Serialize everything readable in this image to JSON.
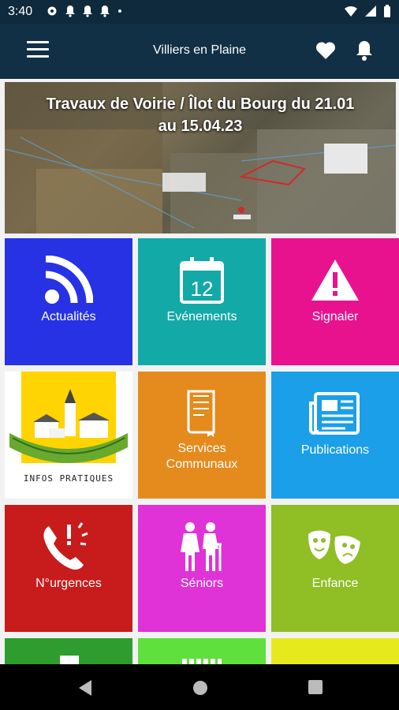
{
  "status": {
    "time": "3:40",
    "left_icons": [
      "settings-icon",
      "bell-icon",
      "bell-icon",
      "bell-icon",
      "dot-icon"
    ],
    "right_icons": [
      "wifi-icon",
      "signal-icon",
      "battery-icon"
    ]
  },
  "appbar": {
    "title": "Villiers en Plaine",
    "icons": [
      "menu-icon",
      "heart-icon",
      "bell-icon"
    ]
  },
  "banner": {
    "title": "Travaux de Voirie / Îlot du Bourg du 21.01 au 15.04.23"
  },
  "tiles": [
    {
      "label": "Actualités",
      "color": "#2632e3",
      "icon": "rss-icon"
    },
    {
      "label": "Evénements",
      "color": "#13a9a7",
      "icon": "calendar-icon",
      "icon_text": "12"
    },
    {
      "label": "Signaler",
      "color": "#e8128e",
      "icon": "warning-icon"
    },
    {
      "label": "INFOS PRATIQUES",
      "color": "#ffffff",
      "icon": "village-icon"
    },
    {
      "label": "Services",
      "label2": "Communaux",
      "color": "#e58a1c",
      "icon": "book-icon"
    },
    {
      "label": "Publications",
      "color": "#1a9fe8",
      "icon": "newspaper-icon"
    },
    {
      "label": "N°urgences",
      "color": "#c81b1b",
      "icon": "phone-alert-icon"
    },
    {
      "label": "Séniors",
      "color": "#df33d8",
      "icon": "seniors-icon"
    },
    {
      "label": "Enfance",
      "color": "#8fbe25",
      "icon": "masks-icon"
    },
    {
      "label": "",
      "color": "#2f9c2f",
      "icon": ""
    },
    {
      "label": "",
      "color": "#5fe03c",
      "icon": ""
    },
    {
      "label": "",
      "color": "#e6ea1c",
      "icon": ""
    }
  ],
  "navbar": {
    "icons": [
      "back-icon",
      "home-icon",
      "recents-icon"
    ]
  }
}
